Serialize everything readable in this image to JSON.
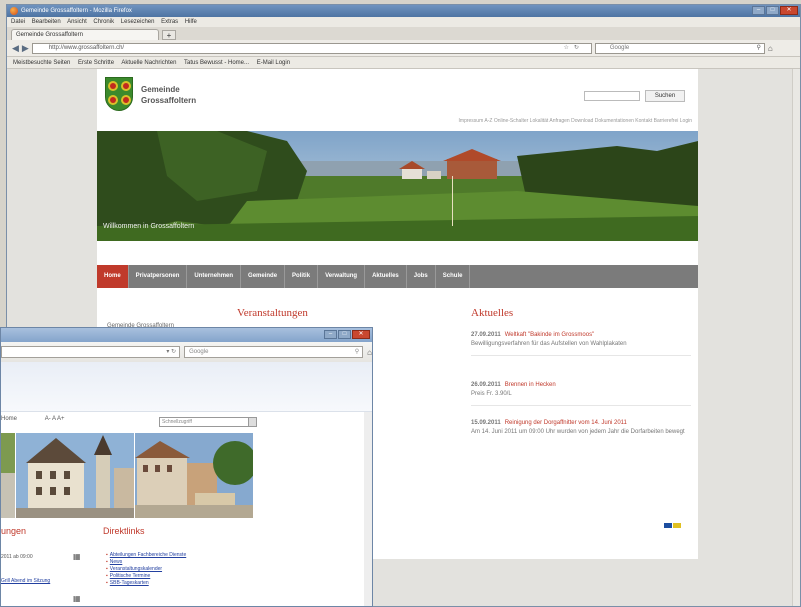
{
  "back_window": {
    "title": "Gemeinde Grossaffoltern - Mozilla Firefox",
    "menu": [
      "Datei",
      "Bearbeiten",
      "Ansicht",
      "Chronik",
      "Lesezeichen",
      "Extras",
      "Hilfe"
    ],
    "tab_label": "Gemeinde Grossaffoltern",
    "url": "http://www.grossaffoltern.ch/",
    "search_placeholder": "Google",
    "bookmarks": [
      "Meistbesuchte Seiten",
      "Erste Schritte",
      "Aktuelle Nachrichten",
      "Tatus Bewusst - Home...",
      "E-Mail Login"
    ]
  },
  "site": {
    "name_line1": "Gemeinde",
    "name_line2": "Grossaffoltern",
    "search_button": "Suchen",
    "toplinks": "Impressum A-Z   Online-Schalter   Lokalität   Anfragen   Download   Dokumentationen   Kontakt   Barrierefrei   Login",
    "welcome": "Willkommen in Grossaffoltern",
    "nav": [
      "Home",
      "Privatpersonen",
      "Unternehmen",
      "Gemeinde",
      "Politik",
      "Verwaltung",
      "Aktuelles",
      "Jobs",
      "Schule"
    ],
    "left_item": "Gemeinde Grossaffoltern",
    "events_heading": "Veranstaltungen",
    "news_heading": "Aktuelles",
    "news": [
      {
        "date": "27.09.2011",
        "title": "Weltkaft \"Bakinde im Grossmoos\"",
        "text": "Bewilligungsverfahren für das Aufstellen von Wahlplakaten"
      },
      {
        "date": "26.09.2011",
        "title": "Brennen in Hecken",
        "text": "Preis Fr. 3.90/L"
      },
      {
        "date": "15.09.2011",
        "title": "Reinigung der Dorgaffnitter vom 14. Juni 2011",
        "text": "Am 14. Juni 2011 um 09:00 Uhr wurden von jedem Jahr die Dorfarbeiten bewegt"
      }
    ]
  },
  "front_window": {
    "search_placeholder": "Google",
    "topline_left": "Home",
    "font_tools": "A- A A+",
    "select_placeholder": "Schnellzugriff",
    "events_heading": "ungen",
    "direct_heading": "Direktlinks",
    "event_line1": "2011 ab 09:00",
    "event_line2": "Grill Abend im Sitzung",
    "direct_links": [
      "Abteilungen Fachbereiche Dienste",
      "News",
      "Veranstaltungskalender",
      "Politische Termine",
      "SBB-Tageskarten"
    ]
  },
  "colors": {
    "accent": "#c0392b",
    "nav_bg": "#7b7b7b",
    "title_blue": "#5a7fb0"
  }
}
